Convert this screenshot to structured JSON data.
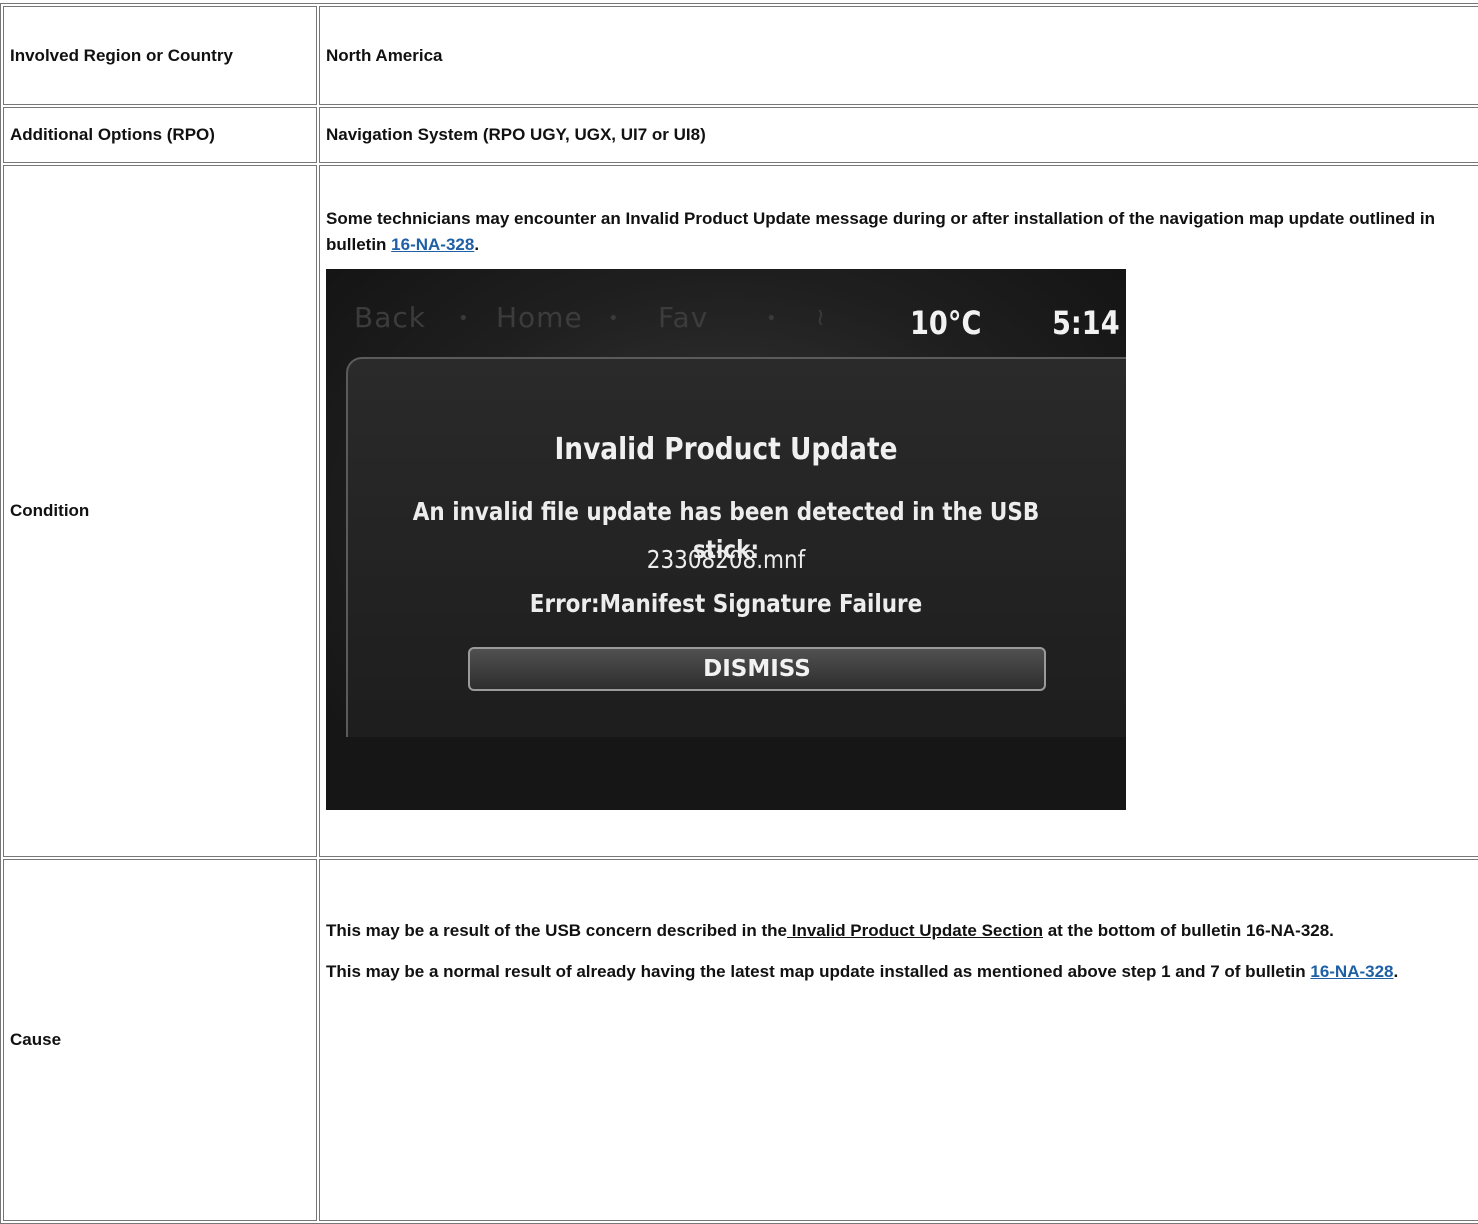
{
  "rows": {
    "region": {
      "label": "Involved Region or Country",
      "value": "North America"
    },
    "options": {
      "label": "Additional Options (RPO)",
      "value": "Navigation System (RPO UGY, UGX, UI7 or UI8)"
    },
    "condition": {
      "label": "Condition",
      "text_before": "Some technicians may encounter an Invalid Product Update message during or after installation of the navigation map update outlined in bulletin ",
      "link": "16-NA-328",
      "text_after": "."
    },
    "cause": {
      "label": "Cause",
      "para1_before": "This may be a result of the USB concern described in the",
      "para1_link": " Invalid Product Update Section",
      "para1_after": " at the bottom of bulletin 16-NA-328.",
      "para2_before": "This may be a normal result of already having the latest map update installed as mentioned above step 1 and 7 of bulletin ",
      "para2_link": "16-NA-328",
      "para2_after": "."
    }
  },
  "nav_screen": {
    "top_back": "Back",
    "top_home": "Home",
    "top_fav": "Fav",
    "temperature": "10°C",
    "time": "5:14",
    "popup_title": "Invalid Product Update",
    "popup_message": "An invalid file update has been detected in the USB stick:",
    "popup_file": "23308208.mnf",
    "popup_error": "Error:Manifest Signature Failure",
    "dismiss_label": "DISMISS"
  }
}
